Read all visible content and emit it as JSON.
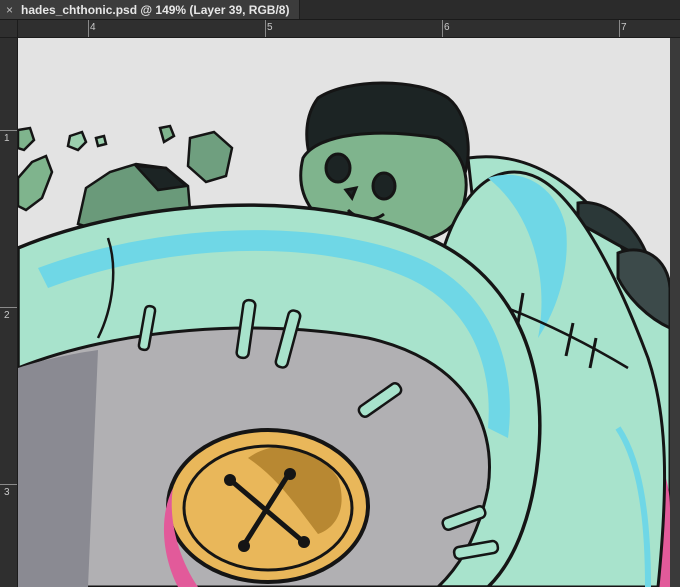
{
  "document": {
    "tab_title": "hades_chthonic.psd @ 149% (Layer 39, RGB/8)",
    "close_symbol": "×"
  },
  "rulers": {
    "horizontal_labels": [
      "4",
      "5",
      "6",
      "7"
    ],
    "vertical_labels": [
      "1",
      "2",
      "3"
    ]
  },
  "artwork": {
    "background": "#e3e3e3",
    "colors": {
      "mint": "#a8e3cc",
      "mint_shadow": "#8ecdb6",
      "cyan_rim": "#6fd7e6",
      "grey_face": "#b1b0b3",
      "gold_button": "#e9b75a",
      "gold_shadow": "#b88832",
      "skull_green": "#7fb48d",
      "rock_dark": "#1c2424",
      "magenta_rim": "#e25a9a",
      "outline": "#151515"
    }
  }
}
